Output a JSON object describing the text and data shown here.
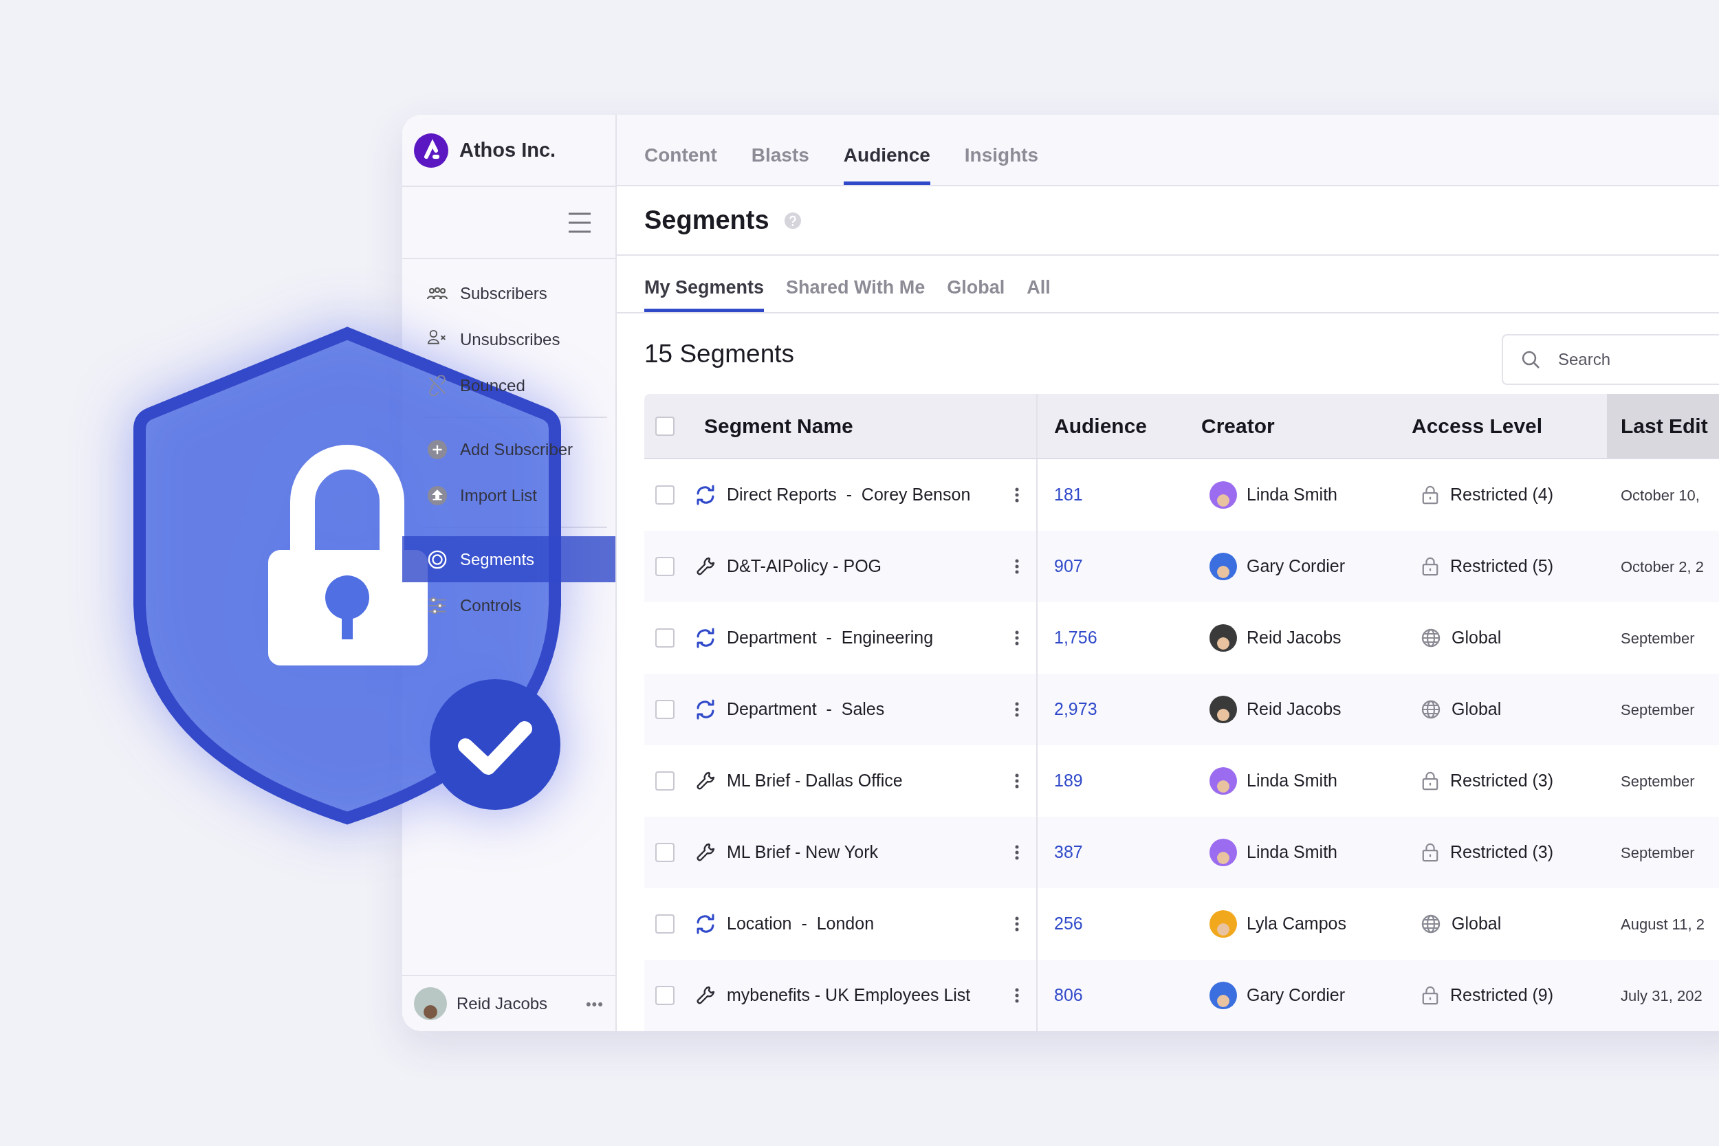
{
  "brand": {
    "name": "Athos Inc."
  },
  "nav_tabs": [
    {
      "label": "Content",
      "selected": false
    },
    {
      "label": "Blasts",
      "selected": false
    },
    {
      "label": "Audience",
      "selected": true
    },
    {
      "label": "Insights",
      "selected": false
    }
  ],
  "sidebar": {
    "groups": [
      [
        {
          "label": "Subscribers",
          "selected": false
        },
        {
          "label": "Unsubscribes",
          "selected": false
        },
        {
          "label": "Bounced",
          "selected": false
        }
      ],
      [
        {
          "label": "Add Subscriber",
          "selected": false
        },
        {
          "label": "Import List",
          "selected": false
        }
      ],
      [
        {
          "label": "Segments",
          "selected": true
        },
        {
          "label": "Controls",
          "selected": false
        }
      ]
    ],
    "user": {
      "name": "Reid Jacobs",
      "menu": "•••"
    }
  },
  "page_title": "Segments",
  "sub_tabs": [
    {
      "label": "My Segments",
      "selected": true
    },
    {
      "label": "Shared With Me",
      "selected": false
    },
    {
      "label": "Global",
      "selected": false
    },
    {
      "label": "All",
      "selected": false
    }
  ],
  "count": "15 Segments",
  "search": {
    "placeholder": "Search"
  },
  "table": {
    "select_all": {
      "checked": false
    },
    "columns": [
      "Segment Name",
      "Audience",
      "Creator",
      "Access Level",
      "Last Edit"
    ],
    "rows": [
      {
        "checked": false,
        "kind": "synced",
        "name": "Direct Reports  -  Corey Benson",
        "audience": "181",
        "creator": {
          "name": "Linda Smith",
          "color": "#9b6cf0"
        },
        "access": {
          "kind": "restricted",
          "label": "Restricted (4)"
        },
        "last_edit": "October 10,"
      },
      {
        "checked": false,
        "kind": "manual",
        "name": "D&T-AIPolicy - POG",
        "audience": "907",
        "creator": {
          "name": "Gary Cordier",
          "color": "#3b6fe0"
        },
        "access": {
          "kind": "restricted",
          "label": "Restricted (5)"
        },
        "last_edit": "October 2, 2"
      },
      {
        "checked": false,
        "kind": "synced",
        "name": "Department  -  Engineering",
        "audience": "1,756",
        "creator": {
          "name": "Reid Jacobs",
          "color": "#3a3a3a"
        },
        "access": {
          "kind": "global",
          "label": "Global"
        },
        "last_edit": "September"
      },
      {
        "checked": false,
        "kind": "synced",
        "name": "Department  -  Sales",
        "audience": "2,973",
        "creator": {
          "name": "Reid Jacobs",
          "color": "#3a3a3a"
        },
        "access": {
          "kind": "global",
          "label": "Global"
        },
        "last_edit": "September"
      },
      {
        "checked": false,
        "kind": "manual",
        "name": "ML Brief - Dallas Office",
        "audience": "189",
        "creator": {
          "name": "Linda Smith",
          "color": "#9b6cf0"
        },
        "access": {
          "kind": "restricted",
          "label": "Restricted (3)"
        },
        "last_edit": "September"
      },
      {
        "checked": false,
        "kind": "manual",
        "name": "ML Brief - New York",
        "audience": "387",
        "creator": {
          "name": "Linda Smith",
          "color": "#9b6cf0"
        },
        "access": {
          "kind": "restricted",
          "label": "Restricted (3)"
        },
        "last_edit": "September"
      },
      {
        "checked": false,
        "kind": "synced",
        "name": "Location  -  London",
        "audience": "256",
        "creator": {
          "name": "Lyla Campos",
          "color": "#f2a81d"
        },
        "access": {
          "kind": "global",
          "label": "Global"
        },
        "last_edit": "August 11, 2"
      },
      {
        "checked": false,
        "kind": "manual",
        "name": "mybenefits - UK Employees List",
        "audience": "806",
        "creator": {
          "name": "Gary Cordier",
          "color": "#3b6fe0"
        },
        "access": {
          "kind": "restricted",
          "label": "Restricted (9)"
        },
        "last_edit": "July 31, 202"
      }
    ]
  }
}
